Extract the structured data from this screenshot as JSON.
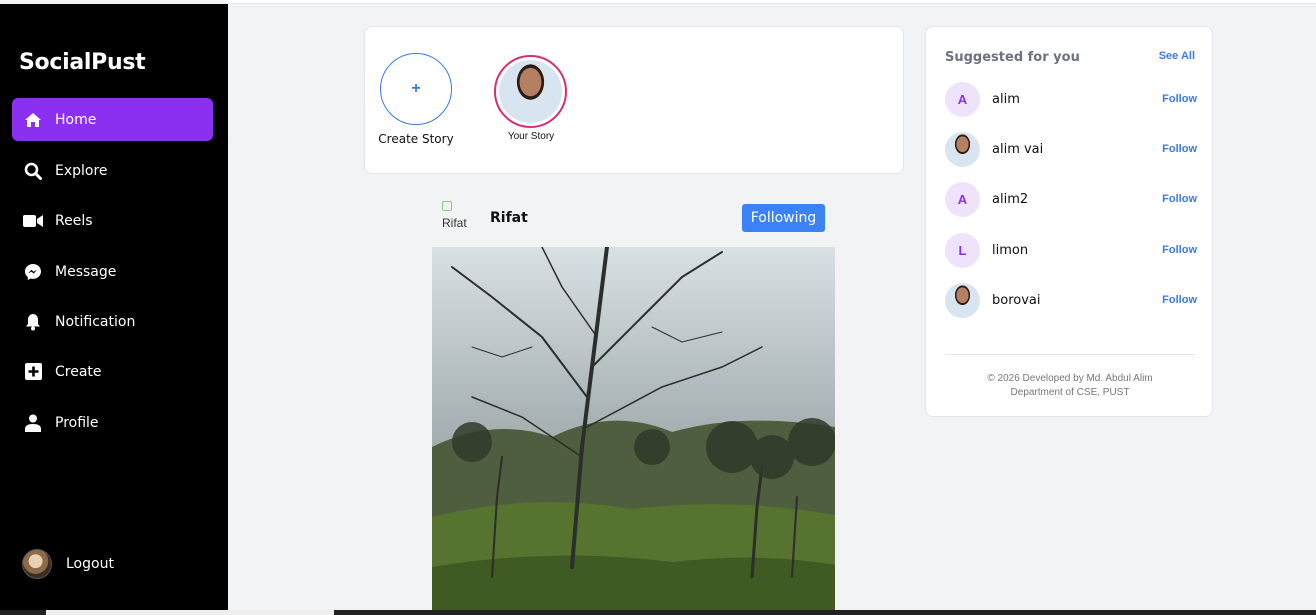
{
  "sidebar": {
    "brand": "SocialPust",
    "items": [
      {
        "label": "Home",
        "icon": "home-icon"
      },
      {
        "label": "Explore",
        "icon": "search-icon"
      },
      {
        "label": "Reels",
        "icon": "video-icon"
      },
      {
        "label": "Message",
        "icon": "messenger-icon"
      },
      {
        "label": "Notification",
        "icon": "bell-icon"
      },
      {
        "label": "Create",
        "icon": "plus-square-icon"
      },
      {
        "label": "Profile",
        "icon": "user-icon"
      }
    ],
    "logout_label": "Logout"
  },
  "stories": {
    "create_label": "Create Story",
    "create_symbol": "+",
    "own_label": "Your Story"
  },
  "post": {
    "avatar_alt": "Rifat",
    "username": "Rifat",
    "follow_label": "Following"
  },
  "suggested": {
    "title": "Suggested for you",
    "see_all": "See All",
    "users": [
      {
        "initial": "A",
        "name": "alim",
        "action": "Follow",
        "photo": false
      },
      {
        "initial": "",
        "name": "alim vai",
        "action": "Follow",
        "photo": true
      },
      {
        "initial": "A",
        "name": "alim2",
        "action": "Follow",
        "photo": false
      },
      {
        "initial": "L",
        "name": "limon",
        "action": "Follow",
        "photo": false
      },
      {
        "initial": "",
        "name": "borovai",
        "action": "Follow",
        "photo": true
      }
    ],
    "credit_line1": "© 2026 Developed by Md. Abdul Alim",
    "credit_line2": "Department of CSE, PUST"
  },
  "colors": {
    "accent": "#8b2ff0",
    "link": "#3b7ae0",
    "button": "#3b82f6",
    "story_ring": "#d62d7a"
  }
}
